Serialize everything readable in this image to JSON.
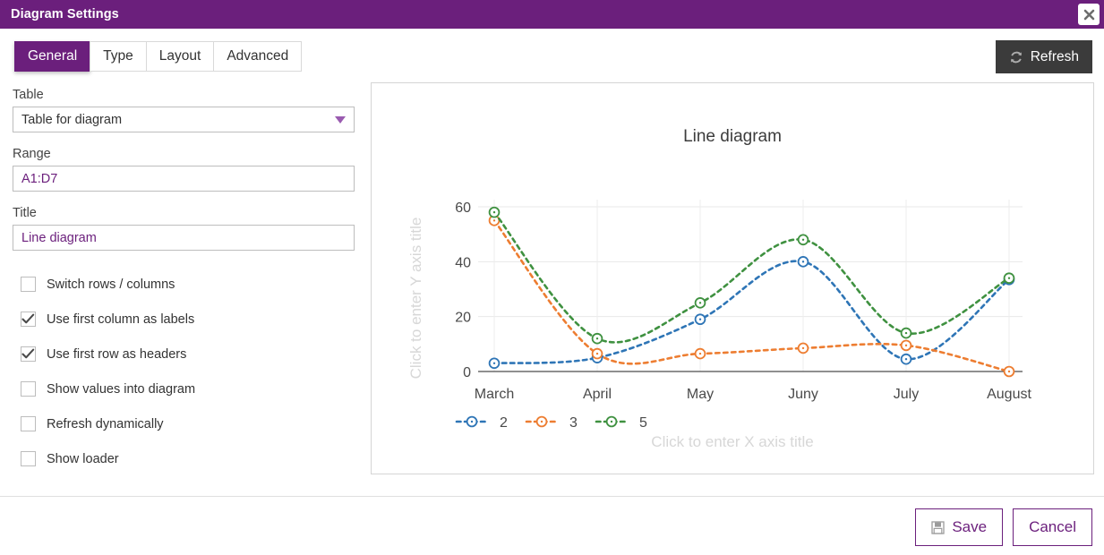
{
  "window": {
    "title": "Diagram Settings",
    "close_label": "×",
    "accent_color": "#6b1f7c"
  },
  "tabs": [
    {
      "label": "General",
      "active": true
    },
    {
      "label": "Type",
      "active": false
    },
    {
      "label": "Layout",
      "active": false
    },
    {
      "label": "Advanced",
      "active": false
    }
  ],
  "toolbar": {
    "refresh_label": "Refresh",
    "refresh_bg": "#3b3b3b"
  },
  "form": {
    "table": {
      "label": "Table",
      "value": "Table for diagram"
    },
    "range": {
      "label": "Range",
      "value": "A1:D7"
    },
    "title": {
      "label": "Title",
      "value": "Line diagram"
    },
    "checkboxes": [
      {
        "label": "Switch rows / columns",
        "checked": false
      },
      {
        "label": "Use first column as labels",
        "checked": true
      },
      {
        "label": "Use first row as headers",
        "checked": true
      },
      {
        "label": "Show values into diagram",
        "checked": false
      },
      {
        "label": "Refresh dynamically",
        "checked": false
      },
      {
        "label": "Show loader",
        "checked": false
      }
    ]
  },
  "footer": {
    "save_label": "Save",
    "cancel_label": "Cancel"
  },
  "chart_data": {
    "type": "line",
    "title": "Line diagram",
    "xlabel": "Click to enter X axis title",
    "ylabel": "Click to enter Y axis title",
    "xlabel_is_placeholder": true,
    "ylabel_is_placeholder": true,
    "categories": [
      "March",
      "April",
      "May",
      "Juny",
      "July",
      "August"
    ],
    "series": [
      {
        "name": "2",
        "color": "#2e75b6",
        "values": [
          3,
          5,
          19,
          40,
          4.5,
          33.5
        ]
      },
      {
        "name": "3",
        "color": "#ed7d31",
        "values": [
          55,
          6.5,
          6.5,
          8.5,
          9.5,
          0
        ]
      },
      {
        "name": "5",
        "color": "#3f9140",
        "values": [
          58,
          12,
          25,
          48,
          14,
          34
        ]
      }
    ],
    "ylim": [
      0,
      62
    ],
    "yticks": [
      0,
      20,
      40,
      60
    ],
    "ytick_labels": [
      "0",
      "20",
      "40",
      "60"
    ],
    "grid": true,
    "line_style": "dashed",
    "marker": "circle",
    "legend_position": "bottom-left",
    "legend_entries": [
      "2",
      "3",
      "5"
    ]
  }
}
